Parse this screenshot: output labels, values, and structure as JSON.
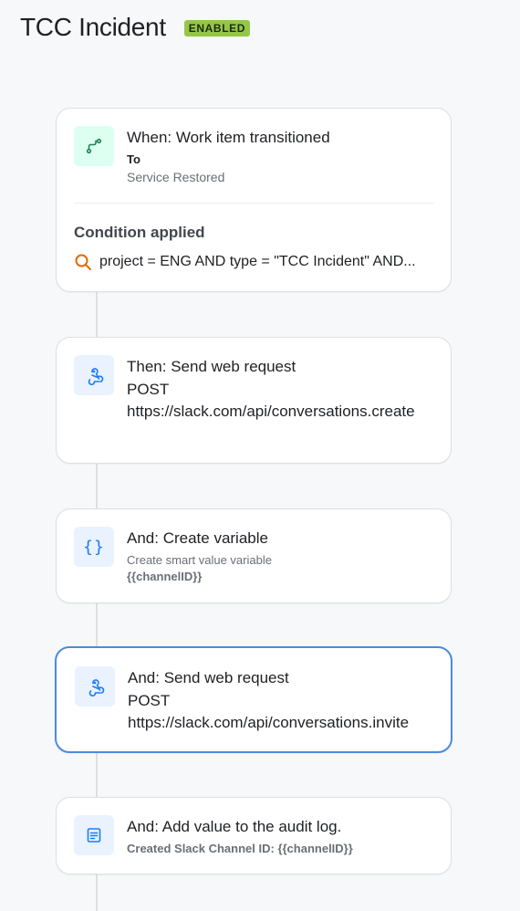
{
  "rule": {
    "title": "TCC Incident",
    "status": "ENABLED"
  },
  "trigger": {
    "title": "When: Work item transitioned",
    "to_label": "To",
    "to_value": "Service Restored",
    "condition_heading": "Condition applied",
    "condition_text": "project = ENG AND type = \"TCC Incident\" AND..."
  },
  "steps": [
    {
      "title": "Then: Send web request",
      "method": "POST",
      "url": "https://slack.com/api/conversations.create"
    },
    {
      "title": "And: Create variable",
      "description": "Create smart value variable",
      "detail": "{{channelID}}"
    },
    {
      "title": "And: Send web request",
      "method": "POST",
      "url": "https://slack.com/api/conversations.invite"
    },
    {
      "title": "And: Add value to the audit log.",
      "detail": "Created Slack Channel ID: {{channelID}}"
    }
  ],
  "colors": {
    "badge": "#94c748",
    "selected_border": "#4b8ae0",
    "trigger_icon": "#1f845a",
    "action_icon": "#1d7afc",
    "search_icon": "#e06c00"
  },
  "icons": {
    "trigger": "branch-path-icon",
    "web_request": "webhook-icon",
    "variable": "curly-braces-icon",
    "audit_log": "document-icon",
    "condition": "search-icon"
  }
}
